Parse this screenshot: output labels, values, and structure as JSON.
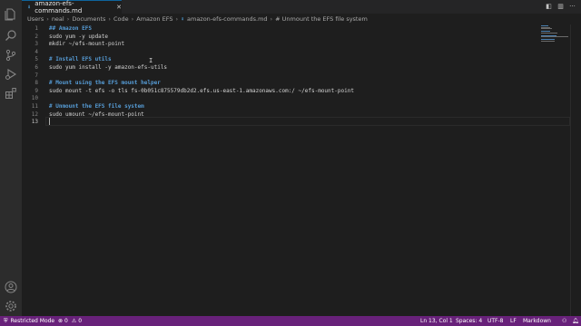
{
  "tab": {
    "label": "amazon-efs-commands.md",
    "icon": "markdown-icon"
  },
  "breadcrumb": {
    "segments": [
      "Users",
      "neal",
      "Documents",
      "Code",
      "Amazon EFS",
      "amazon-efs-commands.md",
      "# Unmount the EFS file system"
    ]
  },
  "editor": {
    "lines": [
      {
        "n": "1",
        "text": "## Amazon EFS",
        "kind": "heading"
      },
      {
        "n": "2",
        "text": "sudo yum -y update",
        "kind": "code"
      },
      {
        "n": "3",
        "text": "mkdir ~/efs-mount-point",
        "kind": "code"
      },
      {
        "n": "4",
        "text": "",
        "kind": "code"
      },
      {
        "n": "5",
        "text": "# Install EFS utils",
        "kind": "heading"
      },
      {
        "n": "6",
        "text": "sudo yum install -y amazon-efs-utils",
        "kind": "code"
      },
      {
        "n": "7",
        "text": "",
        "kind": "code"
      },
      {
        "n": "8",
        "text": "# Mount using the EFS mount helper",
        "kind": "heading"
      },
      {
        "n": "9",
        "text": "sudo mount -t efs -o tls fs-0b051c875579db2d2.efs.us-east-1.amazonaws.com:/ ~/efs-mount-point",
        "kind": "code"
      },
      {
        "n": "10",
        "text": "",
        "kind": "code"
      },
      {
        "n": "11",
        "text": "# Unmount the EFS file system",
        "kind": "heading"
      },
      {
        "n": "12",
        "text": "sudo umount ~/efs-mount-point",
        "kind": "code"
      },
      {
        "n": "13",
        "text": "",
        "kind": "code"
      }
    ]
  },
  "statusbar": {
    "restricted": "Restricted Mode",
    "errors": "0",
    "warnings": "0",
    "position": "Ln 13, Col 1",
    "spaces": "Spaces: 4",
    "encoding": "UTF-8",
    "eol": "LF",
    "language": "Markdown"
  },
  "colors": {
    "statusbar": "#68217a",
    "heading": "#569cd6",
    "editor_bg": "#1e1e1e"
  }
}
